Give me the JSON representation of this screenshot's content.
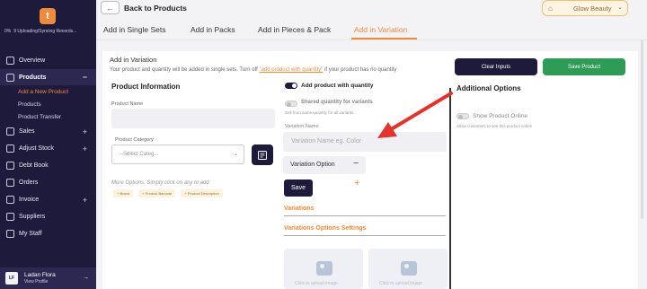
{
  "sidebar": {
    "logo_glyph": "t",
    "sync_pct": "0%",
    "sync_text": "9 Uploading/Syncing Records...",
    "items": [
      {
        "label": "Overview",
        "icon": "grid-icon",
        "expand": ""
      },
      {
        "label": "Products",
        "icon": "box-icon",
        "expand": "−"
      },
      {
        "label": "Sales",
        "icon": "cart-icon",
        "expand": "+"
      },
      {
        "label": "Adjust Stock",
        "icon": "stock-icon",
        "expand": "+"
      },
      {
        "label": "Debt Book",
        "icon": "book-icon",
        "expand": ""
      },
      {
        "label": "Orders",
        "icon": "orders-icon",
        "expand": ""
      },
      {
        "label": "Invoice",
        "icon": "invoice-icon",
        "expand": "+"
      },
      {
        "label": "Suppliers",
        "icon": "suppliers-icon",
        "expand": ""
      },
      {
        "label": "My Staff",
        "icon": "staff-icon",
        "expand": ""
      }
    ],
    "sub_items": [
      "Add a New Product",
      "Products",
      "Product Transfer"
    ],
    "user": {
      "initials": "LF",
      "name": "Ladan Flora",
      "link": "View Profile",
      "arrow": "→"
    }
  },
  "header": {
    "back_glyph": "←",
    "title": "Back to Products",
    "store": "Glow Beauty",
    "store_chevron": "⌄"
  },
  "tabs": [
    "Add in Single Sets",
    "Add in Packs",
    "Add in Pieces & Pack",
    "Add in Variation"
  ],
  "active_tab": "Add in Variation",
  "section": {
    "title": "Add in Variation",
    "desc_pre": "Your product and quantity will be added in single sets. Turn off ",
    "desc_link": "\"add product with quantity\"",
    "desc_post": " if your product has no quantity",
    "clear_label": "Clear Inputs",
    "save_product_label": "Save Product"
  },
  "product_info": {
    "title": "Product Information",
    "name_label": "Product Name",
    "category_label": "Product Category",
    "category_placeholder": "--Select Categ...",
    "more_options": "More Options, Simply click on any to add",
    "chips": [
      "+ Brand",
      "+ Product Barcode",
      "+ Product Description"
    ]
  },
  "variation": {
    "with_quantity_label": "Add product with quantity",
    "shared_label": "Shared quantity for variants",
    "shared_sub": "Sell from same quantity for all variants.",
    "name_label": "Variation Name",
    "name_placeholder": "Variation Name eg. Color",
    "option_label": "Variation Option",
    "option_minus": "−",
    "save_label": "Save",
    "plus_glyph": "+",
    "variations_heading": "Variations",
    "settings_heading": "Variations Options Settings",
    "image_hint": "Click to upload image"
  },
  "additional": {
    "title": "Additional Options",
    "show_online_label": "Show Product Online",
    "show_online_sub": "Allow customers to see this product online"
  },
  "colors": {
    "sidebar": "#1e1a3c",
    "accent": "#f08a3c",
    "save_green": "#2e9b57",
    "arrow": "#e0342c"
  }
}
